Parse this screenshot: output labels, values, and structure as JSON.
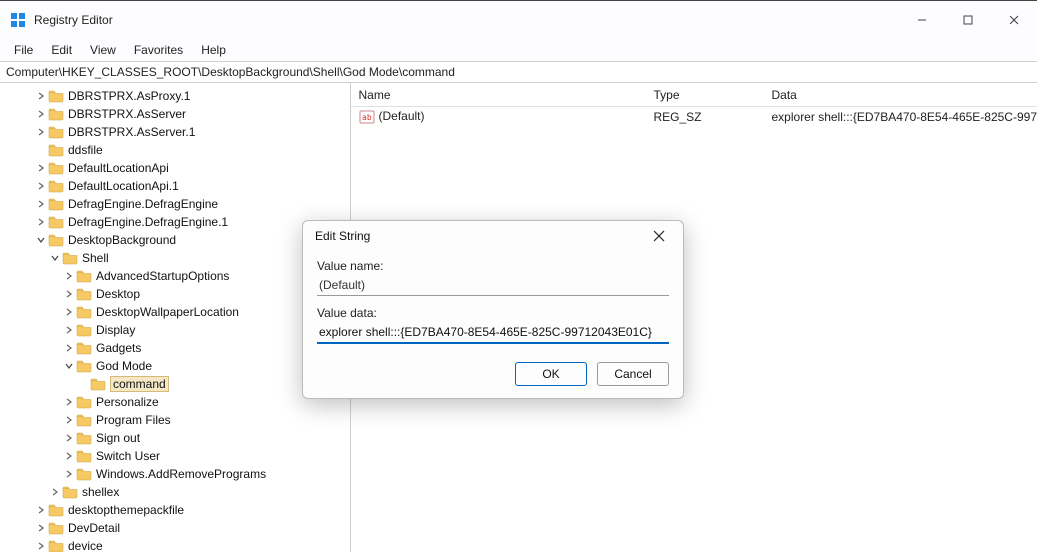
{
  "window": {
    "title": "Registry Editor",
    "controls": {
      "minimize": "—",
      "maximize": "▢",
      "close": "✕"
    }
  },
  "menu": [
    "File",
    "Edit",
    "View",
    "Favorites",
    "Help"
  ],
  "address": "Computer\\HKEY_CLASSES_ROOT\\DesktopBackground\\Shell\\God Mode\\command",
  "tree": [
    {
      "depth": 2,
      "chev": ">",
      "label": "DBRSTPRX.AsProxy.1"
    },
    {
      "depth": 2,
      "chev": ">",
      "label": "DBRSTPRX.AsServer"
    },
    {
      "depth": 2,
      "chev": ">",
      "label": "DBRSTPRX.AsServer.1"
    },
    {
      "depth": 2,
      "chev": "",
      "label": "ddsfile"
    },
    {
      "depth": 2,
      "chev": ">",
      "label": "DefaultLocationApi"
    },
    {
      "depth": 2,
      "chev": ">",
      "label": "DefaultLocationApi.1"
    },
    {
      "depth": 2,
      "chev": ">",
      "label": "DefragEngine.DefragEngine"
    },
    {
      "depth": 2,
      "chev": ">",
      "label": "DefragEngine.DefragEngine.1"
    },
    {
      "depth": 2,
      "chev": "v",
      "label": "DesktopBackground"
    },
    {
      "depth": 3,
      "chev": "v",
      "label": "Shell"
    },
    {
      "depth": 4,
      "chev": ">",
      "label": "AdvancedStartupOptions"
    },
    {
      "depth": 4,
      "chev": ">",
      "label": "Desktop"
    },
    {
      "depth": 4,
      "chev": ">",
      "label": "DesktopWallpaperLocation"
    },
    {
      "depth": 4,
      "chev": ">",
      "label": "Display"
    },
    {
      "depth": 4,
      "chev": ">",
      "label": "Gadgets"
    },
    {
      "depth": 4,
      "chev": "v",
      "label": "God Mode"
    },
    {
      "depth": 5,
      "chev": "",
      "label": "command",
      "selected": true
    },
    {
      "depth": 4,
      "chev": ">",
      "label": "Personalize"
    },
    {
      "depth": 4,
      "chev": ">",
      "label": "Program Files"
    },
    {
      "depth": 4,
      "chev": ">",
      "label": "Sign out"
    },
    {
      "depth": 4,
      "chev": ">",
      "label": "Switch User"
    },
    {
      "depth": 4,
      "chev": ">",
      "label": "Windows.AddRemovePrograms"
    },
    {
      "depth": 3,
      "chev": ">",
      "label": "shellex"
    },
    {
      "depth": 2,
      "chev": ">",
      "label": "desktopthemepackfile"
    },
    {
      "depth": 2,
      "chev": ">",
      "label": "DevDetail"
    },
    {
      "depth": 2,
      "chev": ">",
      "label": "device"
    }
  ],
  "list": {
    "headers": {
      "name": "Name",
      "type": "Type",
      "data": "Data"
    },
    "rows": [
      {
        "name": "(Default)",
        "type": "REG_SZ",
        "data": "explorer shell:::{ED7BA470-8E54-465E-825C-997"
      }
    ]
  },
  "dialog": {
    "title": "Edit String",
    "valueNameLabel": "Value name:",
    "valueName": "(Default)",
    "valueDataLabel": "Value data:",
    "valueData": "explorer shell:::{ED7BA470-8E54-465E-825C-99712043E01C}",
    "ok": "OK",
    "cancel": "Cancel"
  }
}
